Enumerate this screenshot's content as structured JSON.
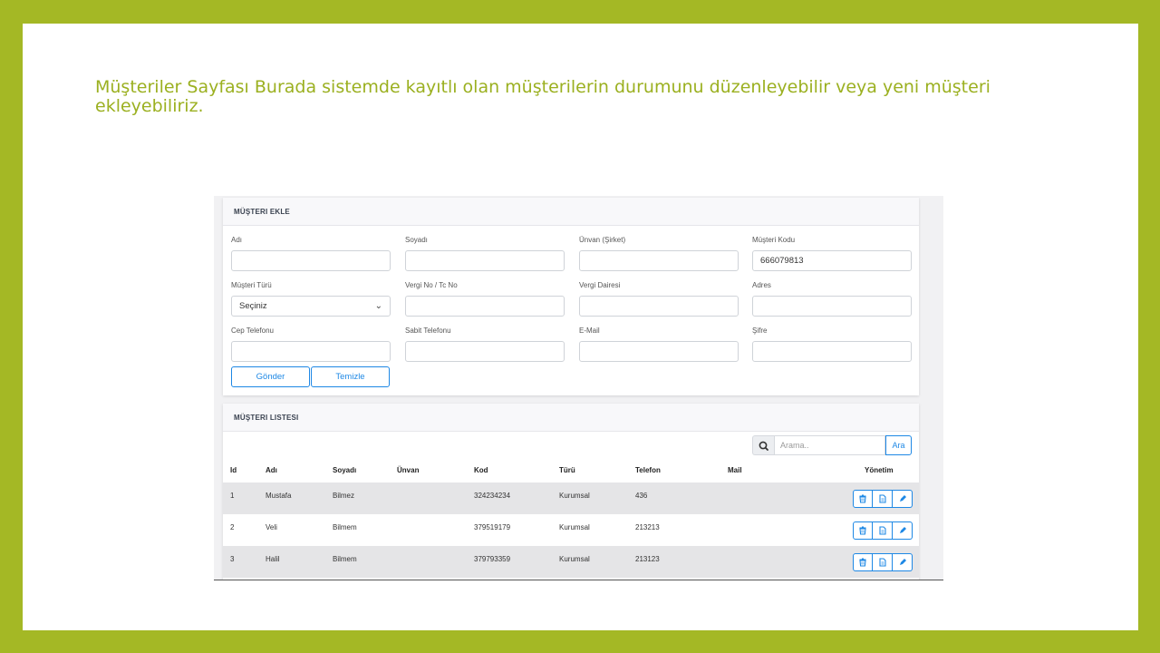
{
  "slide": {
    "title": "Müşteriler Sayfası Burada sistemde kayıtlı olan müşterilerin durumunu düzenleyebilir veya yeni müşteri ekleyebiliriz."
  },
  "form": {
    "heading": "MÜŞTERI EKLE",
    "fields": [
      {
        "label": "Adı",
        "value": ""
      },
      {
        "label": "Soyadı",
        "value": ""
      },
      {
        "label": "Ünvan (Şirket)",
        "value": ""
      },
      {
        "label": "Müşteri Kodu",
        "value": "666079813"
      },
      {
        "label": "Müşteri Türü",
        "value": "Seçiniz"
      },
      {
        "label": "Vergi No / Tc No",
        "value": ""
      },
      {
        "label": "Vergi Dairesi",
        "value": ""
      },
      {
        "label": "Adres",
        "value": ""
      },
      {
        "label": "Cep Telefonu",
        "value": ""
      },
      {
        "label": "Sabit Telefonu",
        "value": ""
      },
      {
        "label": "E-Mail",
        "value": ""
      },
      {
        "label": "Şifre",
        "value": ""
      }
    ],
    "submit_label": "Gönder",
    "clear_label": "Temizle"
  },
  "list": {
    "heading": "MÜŞTERI LISTESI",
    "search_placeholder": "Arama..",
    "search_button": "Ara",
    "columns": [
      "Id",
      "Adı",
      "Soyadı",
      "Ünvan",
      "Kod",
      "Türü",
      "Telefon",
      "Mail",
      "Yönetim"
    ],
    "rows": [
      {
        "id": "1",
        "adi": "Mustafa",
        "soyadi": "Bilmez",
        "unvan": "",
        "kod": "324234234",
        "turu": "Kurumsal",
        "telefon": "436",
        "mail": ""
      },
      {
        "id": "2",
        "adi": "Veli",
        "soyadi": "Bilmem",
        "unvan": "",
        "kod": "379519179",
        "turu": "Kurumsal",
        "telefon": "213213",
        "mail": ""
      },
      {
        "id": "3",
        "adi": "Halil",
        "soyadi": "Bilmem",
        "unvan": "",
        "kod": "379793359",
        "turu": "Kurumsal",
        "telefon": "213123",
        "mail": ""
      }
    ]
  },
  "icons": {
    "search": "search-icon",
    "delete": "trash-icon",
    "detail": "document-icon",
    "edit": "pencil-icon"
  },
  "colors": {
    "frame": "#a4b825",
    "title": "#9bb020",
    "accent": "#1e88e5"
  }
}
